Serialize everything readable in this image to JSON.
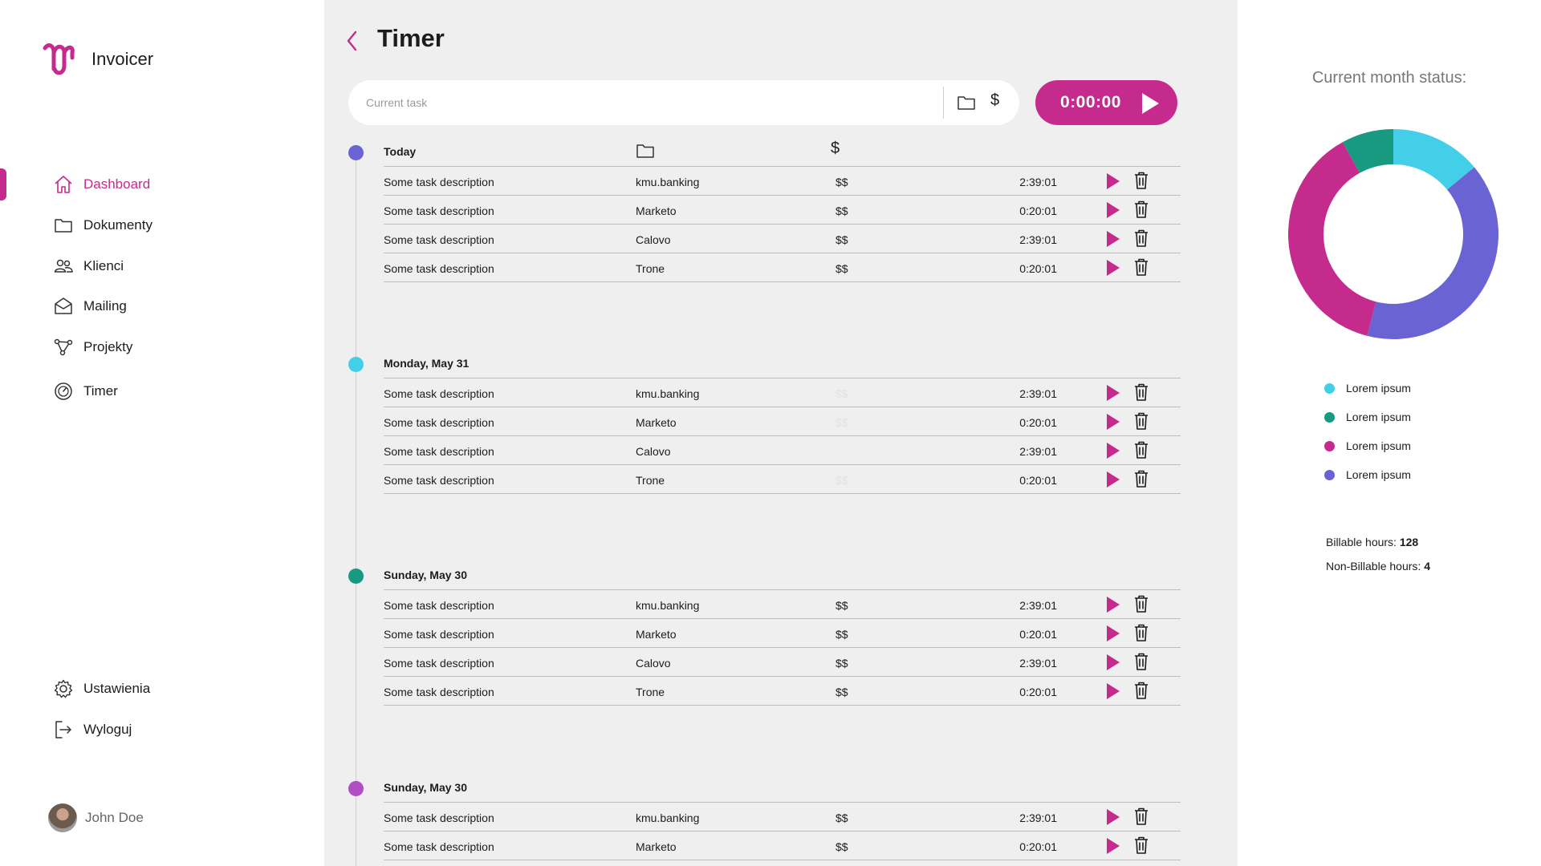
{
  "app": {
    "name": "Invoicer"
  },
  "sidebar": {
    "items": [
      {
        "label": "Dashboard",
        "icon": "home-icon"
      },
      {
        "label": "Dokumenty",
        "icon": "folder-icon"
      },
      {
        "label": "Klienci",
        "icon": "users-icon"
      },
      {
        "label": "Mailing",
        "icon": "mail-icon"
      },
      {
        "label": "Projekty",
        "icon": "projects-icon"
      },
      {
        "label": "Timer",
        "icon": "timer-icon"
      }
    ],
    "bottom": [
      {
        "label": "Ustawienia",
        "icon": "gear-icon"
      },
      {
        "label": "Wyloguj",
        "icon": "logout-icon"
      }
    ],
    "user": {
      "name": "John Doe"
    }
  },
  "header": {
    "title": "Timer"
  },
  "taskbar": {
    "placeholder": "Current task",
    "dollar": "$",
    "timer": "0:00:00"
  },
  "table_header": {
    "dollar": "$"
  },
  "groups": [
    {
      "date": "Today",
      "dot_color": "#6a63d4",
      "rows": [
        {
          "desc": "Some task description",
          "client": "kmu.banking",
          "bill": "$$",
          "time": "2:39:01"
        },
        {
          "desc": "Some task description",
          "client": "Marketo",
          "bill": "$$",
          "time": "0:20:01"
        },
        {
          "desc": "Some task description",
          "client": "Calovo",
          "bill": "$$",
          "time": "2:39:01"
        },
        {
          "desc": "Some task description",
          "client": "Trone",
          "bill": "$$",
          "time": "0:20:01"
        }
      ]
    },
    {
      "date": "Monday, May 31",
      "dot_color": "#43cfe8",
      "rows": [
        {
          "desc": "Some task description",
          "client": "kmu.banking",
          "bill": "$$",
          "time": "2:39:01"
        },
        {
          "desc": "Some task description",
          "client": "Marketo",
          "bill": "$$",
          "time": "0:20:01"
        },
        {
          "desc": "Some task description",
          "client": "Calovo",
          "bill": "",
          "time": "2:39:01"
        },
        {
          "desc": "Some task description",
          "client": "Trone",
          "bill": "$$",
          "time": "0:20:01"
        }
      ]
    },
    {
      "date": "Sunday, May 30",
      "dot_color": "#179a80",
      "rows": [
        {
          "desc": "Some task description",
          "client": "kmu.banking",
          "bill": "$$",
          "time": "2:39:01"
        },
        {
          "desc": "Some task description",
          "client": "Marketo",
          "bill": "$$",
          "time": "0:20:01"
        },
        {
          "desc": "Some task description",
          "client": "Calovo",
          "bill": "$$",
          "time": "2:39:01"
        },
        {
          "desc": "Some task description",
          "client": "Trone",
          "bill": "$$",
          "time": "0:20:01"
        }
      ]
    },
    {
      "date": "Sunday, May 30",
      "dot_color": "#b14ec6",
      "rows": [
        {
          "desc": "Some task description",
          "client": "kmu.banking",
          "bill": "$$",
          "time": "2:39:01"
        },
        {
          "desc": "Some task description",
          "client": "Marketo",
          "bill": "$$",
          "time": "0:20:01"
        }
      ]
    }
  ],
  "status": {
    "title": "Current month status:",
    "chart_data": {
      "type": "pie",
      "series": [
        {
          "name": "Lorem ipsum",
          "color": "#43cfe8",
          "value": 14
        },
        {
          "name": "Lorem ipsum",
          "color": "#6a63d4",
          "value": 40
        },
        {
          "name": "Lorem ipsum",
          "color": "#c42b8d",
          "value": 38
        },
        {
          "name": "Lorem ipsum",
          "color": "#179a80",
          "value": 8
        }
      ]
    },
    "legend": [
      {
        "label": "Lorem ipsum",
        "color": "#43cfe8"
      },
      {
        "label": "Lorem ipsum",
        "color": "#179a80"
      },
      {
        "label": "Lorem ipsum",
        "color": "#c42b8d"
      },
      {
        "label": "Lorem ipsum",
        "color": "#6a63d4"
      }
    ],
    "billable_label": "Billable hours:",
    "billable_value": "128",
    "nonbillable_label": "Non-Billable hours:",
    "nonbillable_value": "4"
  },
  "colors": {
    "accent": "#c42b8d",
    "main_bg": "#efefef"
  }
}
